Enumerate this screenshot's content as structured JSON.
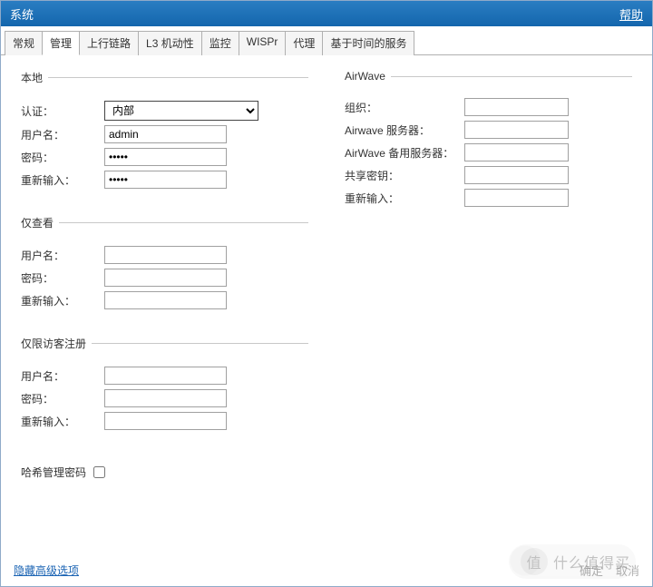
{
  "window": {
    "title": "系统",
    "help": "帮助"
  },
  "tabs": [
    {
      "label": "常规"
    },
    {
      "label": "管理"
    },
    {
      "label": "上行链路"
    },
    {
      "label": "L3 机动性"
    },
    {
      "label": "监控"
    },
    {
      "label": "WISPr"
    },
    {
      "label": "代理"
    },
    {
      "label": "基于时间的服务"
    }
  ],
  "active_tab_index": 1,
  "local": {
    "legend": "本地",
    "auth_label": "认证：",
    "auth_value": "内部",
    "user_label": "用户名：",
    "user_value": "admin",
    "pass_label": "密码：",
    "pass_value": "•••••",
    "retype_label": "重新输入：",
    "retype_value": "•••••"
  },
  "viewonly": {
    "legend": "仅查看",
    "user_label": "用户名：",
    "user_value": "",
    "pass_label": "密码：",
    "pass_value": "",
    "retype_label": "重新输入：",
    "retype_value": ""
  },
  "guest": {
    "legend": "仅限访客注册",
    "user_label": "用户名：",
    "user_value": "",
    "pass_label": "密码：",
    "pass_value": "",
    "retype_label": "重新输入：",
    "retype_value": ""
  },
  "hash": {
    "label": "哈希管理密码",
    "checked": false
  },
  "airwave": {
    "legend": "AirWave",
    "org_label": "组织：",
    "org_value": "",
    "server_label": "Airwave 服务器：",
    "server_value": "",
    "backup_label": "AirWave 备用服务器：",
    "backup_value": "",
    "shared_label": "共享密钥：",
    "shared_value": "",
    "retype_label": "重新输入：",
    "retype_value": ""
  },
  "footer": {
    "hide_advanced": "隐藏高级选项",
    "ok": "确定",
    "cancel": "取消"
  },
  "watermark": "什么值得买"
}
